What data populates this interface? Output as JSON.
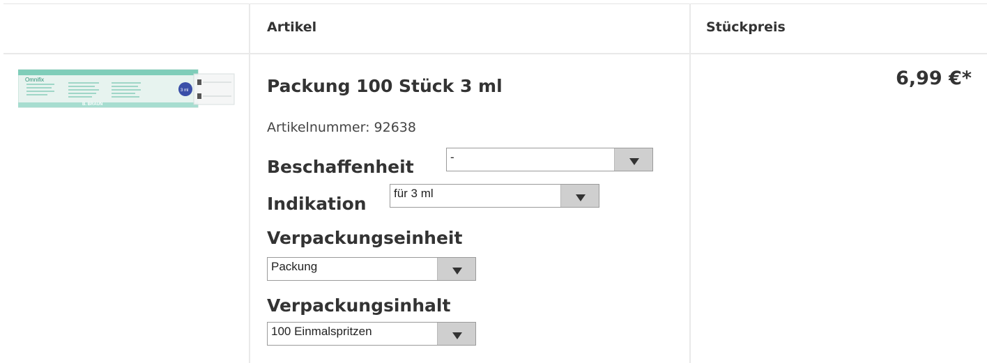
{
  "header": {
    "artikel": "Artikel",
    "stueckpreis": "Stückpreis"
  },
  "product": {
    "title": "Packung 100 Stück 3 ml",
    "artnr_label": "Artikelnummer:",
    "artnr_value": "92638",
    "image_brand": "Omnifix",
    "image_maker": "B. BRAUN",
    "image_size": "3 ml",
    "price": "6,99 €*"
  },
  "options": {
    "beschaffenheit": {
      "label": "Beschaffenheit",
      "value": "-"
    },
    "indikation": {
      "label": "Indikation",
      "value": "für 3 ml"
    },
    "verpackungseinheit": {
      "label": "Verpackungseinheit",
      "value": "Packung"
    },
    "verpackungsinhalt": {
      "label": "Verpackungsinhalt",
      "value": "100 Einmalspritzen"
    }
  },
  "colors": {
    "border": "#e9e9e9",
    "select_button": "#cfcfcf",
    "text": "#333333",
    "box_green": "#8fd4c3"
  }
}
